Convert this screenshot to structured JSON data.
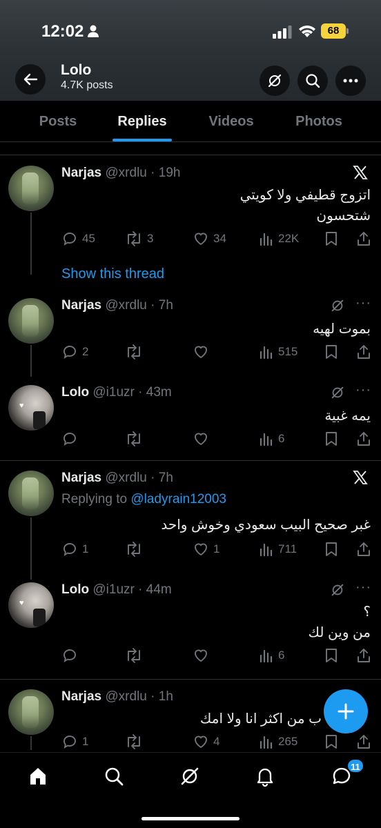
{
  "status_bar": {
    "time": "12:02",
    "battery": "68"
  },
  "header": {
    "title": "Lolo",
    "subtitle": "4.7K posts"
  },
  "tabs": [
    {
      "label": "Posts"
    },
    {
      "label": "Replies"
    },
    {
      "label": "Videos"
    },
    {
      "label": "Photos"
    }
  ],
  "tweets": [
    {
      "name": "Narjas",
      "handle": "@xrdlu",
      "time": "19h",
      "line1": "اتزوج قطيفي ولا كويتي",
      "line2": "شتحسون",
      "replies": "45",
      "reposts": "3",
      "likes": "34",
      "views": "22K"
    },
    {
      "name": "Narjas",
      "handle": "@xrdlu",
      "time": "7h",
      "line1": "بموت لهيه",
      "replies": "2",
      "reposts": "",
      "likes": "",
      "views": "515"
    },
    {
      "name": "Lolo",
      "handle": "@i1uzr",
      "time": "43m",
      "line1": "يمه غبية",
      "replies": "",
      "reposts": "",
      "likes": "",
      "views": "6"
    },
    {
      "name": "Narjas",
      "handle": "@xrdlu",
      "time": "7h",
      "replying_prefix": "Replying to",
      "replying_to": "@ladyrain12003",
      "line1": "غبر صحيح البيب سعودي وخوش واحد",
      "replies": "1",
      "reposts": "",
      "likes": "1",
      "views": "711"
    },
    {
      "name": "Lolo",
      "handle": "@i1uzr",
      "time": "44m",
      "line1": "؟",
      "line2": "من وين لك",
      "replies": "",
      "reposts": "",
      "likes": "",
      "views": "6"
    },
    {
      "name": "Narjas",
      "handle": "@xrdlu",
      "time": "1h",
      "line1": "ب من اكثر انا ولا امك",
      "replies": "1",
      "reposts": "",
      "likes": "4",
      "views": "265"
    }
  ],
  "show_thread": "Show this thread",
  "bottom_nav": {
    "messages_badge": "11"
  },
  "colors": {
    "accent": "#1d9bf0",
    "background": "#000000",
    "muted": "#71767b",
    "divider": "#2f3336"
  },
  "icons": [
    "back-arrow-icon",
    "grok-icon",
    "search-icon",
    "more-icon",
    "x-logo-icon",
    "reply-icon",
    "repost-icon",
    "like-icon",
    "views-icon",
    "bookmark-icon",
    "share-icon",
    "home-icon",
    "bell-icon",
    "messages-icon",
    "plus-icon"
  ]
}
